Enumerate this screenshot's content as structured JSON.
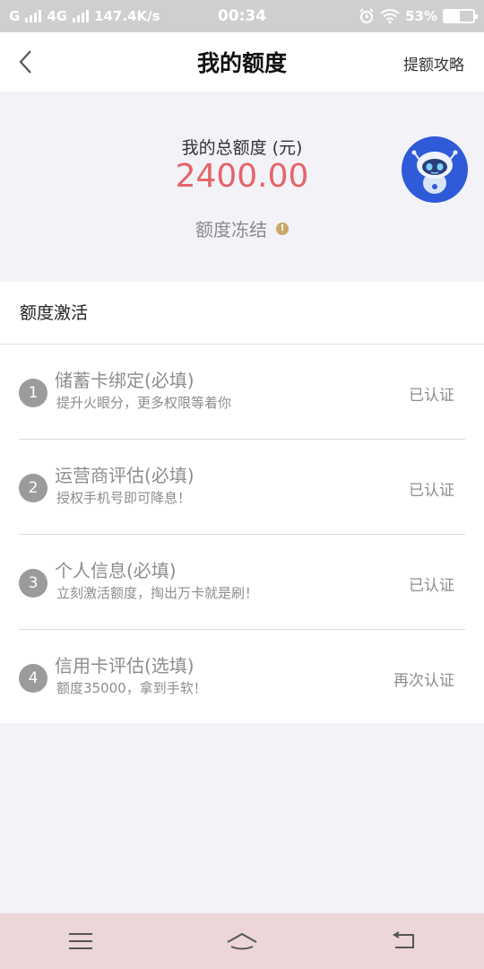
{
  "status_bar": {
    "carrier1": "G",
    "carrier2": "4G",
    "speed": "147.4K/s",
    "time": "00:34",
    "battery": "53%",
    "battery_level": 0.53
  },
  "nav": {
    "title": "我的额度",
    "right_link": "提额攻略"
  },
  "summary": {
    "label": "我的总额度 (元)",
    "amount": "2400.00",
    "freeze_text": "额度冻结",
    "info_glyph": "!"
  },
  "activation": {
    "title": "额度激活",
    "items": [
      {
        "num": "1",
        "title": "储蓄卡绑定(必填)",
        "subtitle": "提升火眼分，更多权限等着你",
        "status": "已认证"
      },
      {
        "num": "2",
        "title": "运营商评估(必填)",
        "subtitle": "授权手机号即可降息！",
        "status": "已认证"
      },
      {
        "num": "3",
        "title": "个人信息(必填)",
        "subtitle": "立刻激活额度，掏出万卡就是刷！",
        "status": "已认证"
      },
      {
        "num": "4",
        "title": "信用卡评估(选填)",
        "subtitle": "额度35000，拿到手软！",
        "status": "再次认证"
      }
    ]
  },
  "colors": {
    "amount": "#e5646b",
    "info_dot": "#c9a86a",
    "robot": "#2f5bd9",
    "bottom_nav": "#ecd6da"
  },
  "icons": {
    "back": "chevron-left-icon",
    "robot": "robot-avatar-icon",
    "menu": "menu-icon",
    "home": "home-icon",
    "return": "return-icon"
  }
}
